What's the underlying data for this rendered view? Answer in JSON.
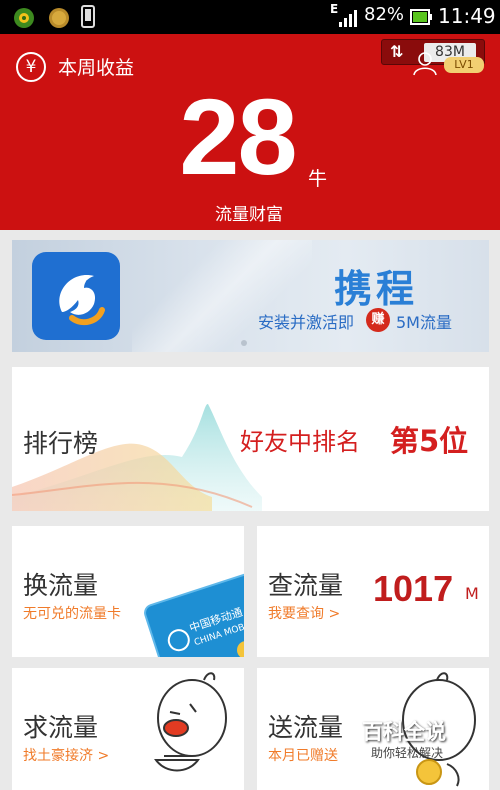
{
  "status_bar": {
    "network": "E",
    "battery": "82%",
    "time": "11:49"
  },
  "header": {
    "currency_symbol": "¥",
    "week_label": "本周收益",
    "traffic_badge": "83M",
    "level": "LV1",
    "points": "28",
    "points_unit": "牛",
    "wealth_label": "流量财富"
  },
  "banner": {
    "brand": "携程",
    "install_text": "安装并激活即",
    "earn_label": "赚",
    "reward": "5M流量"
  },
  "ranking": {
    "title": "排行榜",
    "subtitle": "好友中排名",
    "position": "第5位"
  },
  "cards": {
    "exchange": {
      "title": "换流量",
      "subtitle": "无可兑的流量卡"
    },
    "query": {
      "title": "查流量",
      "subtitle": "我要查询 >",
      "value": "1017",
      "unit": "M"
    },
    "request": {
      "title": "求流量",
      "subtitle": "找土豪接济 >"
    },
    "send": {
      "title": "送流量",
      "subtitle": "本月已赠送"
    }
  },
  "sim_card_text": {
    "cn": "中国移动通",
    "en": "CHINA MOB"
  },
  "watermark": {
    "main": "百科全说",
    "sub": "助你轻松解决"
  },
  "colors": {
    "header_red": "#cc1111",
    "accent_red": "#d41f1f",
    "orange": "#f07b2a",
    "brand_blue": "#2a7fd6"
  }
}
